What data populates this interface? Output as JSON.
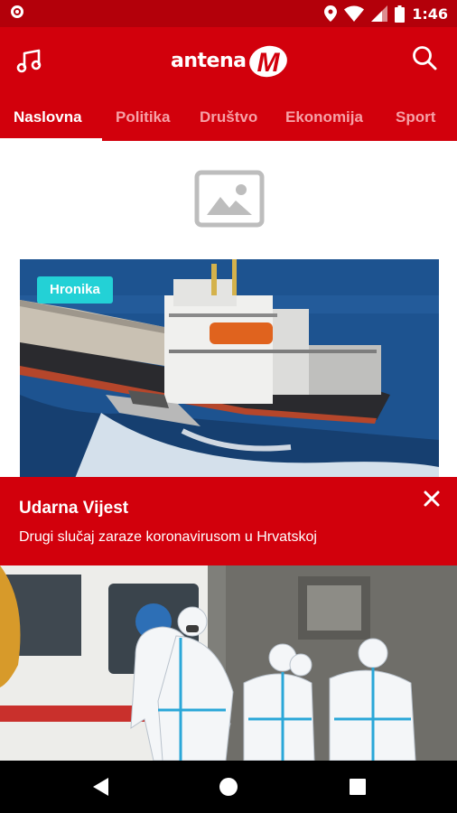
{
  "status_bar": {
    "time": "1:46"
  },
  "app": {
    "logo_text": "antena",
    "logo_mark": "M"
  },
  "tabs": [
    {
      "label": "Naslovna",
      "active": true
    },
    {
      "label": "Politika",
      "active": false
    },
    {
      "label": "Društvo",
      "active": false
    },
    {
      "label": "Ekonomija",
      "active": false
    },
    {
      "label": "Sport",
      "active": false
    }
  ],
  "article": {
    "category": "Hronika"
  },
  "breaking": {
    "title": "Udarna Vijest",
    "text": "Drugi slučaj zaraze koronavirusom u Hrvatskoj"
  },
  "colors": {
    "brand": "#d2000c",
    "status_bar": "#b3000a",
    "badge": "#23d1d6"
  },
  "icons": [
    "music-icon",
    "search-icon",
    "image-placeholder-icon",
    "close-icon",
    "back-icon",
    "home-icon",
    "recents-icon"
  ]
}
